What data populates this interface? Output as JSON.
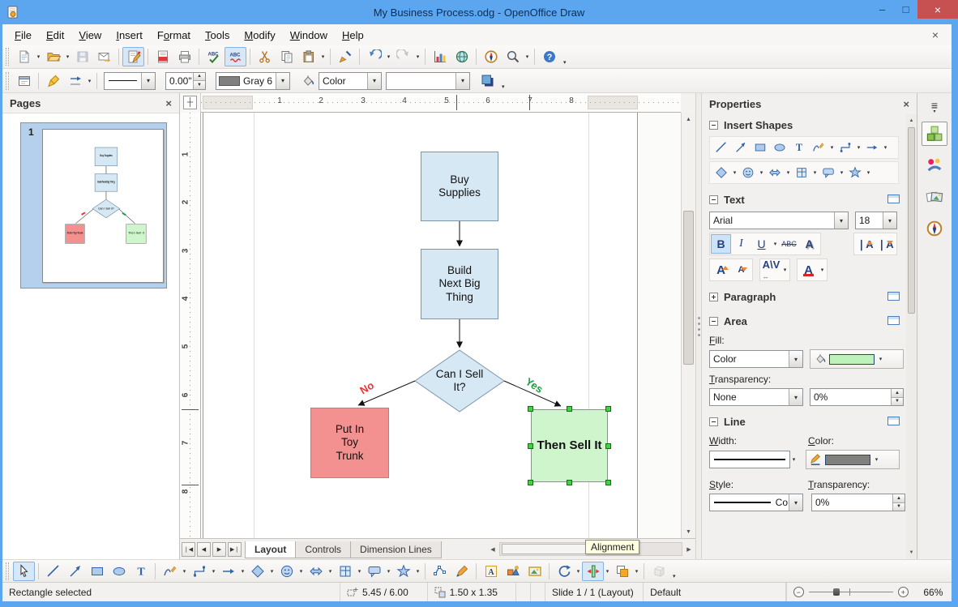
{
  "window": {
    "title": "My Business Process.odg - OpenOffice Draw",
    "minimize": "–",
    "maximize": "□",
    "close": "×"
  },
  "menu": {
    "close": "×",
    "items": [
      {
        "pre": "",
        "accel": "F",
        "post": "ile"
      },
      {
        "pre": "",
        "accel": "E",
        "post": "dit"
      },
      {
        "pre": "",
        "accel": "V",
        "post": "iew"
      },
      {
        "pre": "",
        "accel": "I",
        "post": "nsert"
      },
      {
        "pre": "F",
        "accel": "o",
        "post": "rmat"
      },
      {
        "pre": "",
        "accel": "T",
        "post": "ools"
      },
      {
        "pre": "",
        "accel": "M",
        "post": "odify"
      },
      {
        "pre": "",
        "accel": "W",
        "post": "indow"
      },
      {
        "pre": "",
        "accel": "H",
        "post": "elp"
      }
    ]
  },
  "toolbar_standard": {
    "icons": [
      "new-document",
      "open",
      "save",
      "email-document",
      "edit-mode",
      "export-pdf",
      "print",
      "spellcheck",
      "auto-spellcheck",
      "cut",
      "copy",
      "paste",
      "format-paintbrush",
      "undo",
      "redo",
      "insert-chart",
      "hyperlink",
      "navigator",
      "zoom",
      "help"
    ]
  },
  "toolbar_line_fill": {
    "icons": [
      "styles",
      "editpoints-pen",
      "arrow-style",
      "fill-bucket",
      "shadow"
    ],
    "line_width_value": "0.00\"",
    "line_color_value": "Gray 6",
    "fill_type_value": "Color",
    "fill_color_value": "",
    "line_color_hex": "#808080",
    "fill_color_hex": "#ffffff"
  },
  "pages_panel": {
    "title": "Pages",
    "close": "×",
    "page_number": "1"
  },
  "rulers": {
    "h": [
      "1",
      "2",
      "3",
      "4",
      "5",
      "6",
      "7",
      "8"
    ],
    "v": [
      "1",
      "2",
      "3",
      "4",
      "5",
      "6",
      "7",
      "8"
    ]
  },
  "canvas": {
    "nodes": [
      {
        "label": "Buy Supplies",
        "fill": "#d5e8f4"
      },
      {
        "label": "Build Next Big Thing",
        "fill": "#d5e8f4"
      },
      {
        "label": "Can I Sell It?",
        "fill": "#d5e8f4"
      },
      {
        "label": "Put In Toy Trunk",
        "fill": "#f2918f"
      },
      {
        "label": "Then Sell It",
        "fill": "#cff5cd",
        "selected": true
      }
    ],
    "edge_labels": {
      "no": "No",
      "yes": "Yes"
    },
    "edge_label_colors": {
      "no": "#E33",
      "yes": "#1E9E3E"
    },
    "handle_color": "#43D243"
  },
  "sheet_tabs": {
    "items": [
      {
        "label": "Layout",
        "active": true
      },
      {
        "label": "Controls",
        "active": false
      },
      {
        "label": "Dimension Lines",
        "active": false
      }
    ]
  },
  "tooltip": {
    "text": "Alignment"
  },
  "properties": {
    "title": "Properties",
    "close": "×",
    "insert_shapes": {
      "header": "Insert Shapes",
      "row1": [
        "line",
        "arrow",
        "rectangle",
        "ellipse",
        "text",
        "curve",
        "connector",
        "lines-arrows"
      ],
      "row2": [
        "basic-shapes",
        "symbol-shapes",
        "block-arrows",
        "flowcharts",
        "callouts",
        "stars"
      ]
    },
    "text": {
      "header": "Text",
      "font_name": "Arial",
      "font_size": "18",
      "bold": "B",
      "italic": "I",
      "underline": "U",
      "strike": "ABC",
      "shadow_btn": "A",
      "grow": "A",
      "shrink": "A",
      "spacing": "AV",
      "font_color": "A"
    },
    "paragraph": {
      "header": "Paragraph"
    },
    "area": {
      "header": "Area",
      "fill_label": "Fill:",
      "fill_type": "Color",
      "fill_color_hex": "#BDF2BB",
      "transparency_label": "Transparency:",
      "transparency_type": "None",
      "transparency_value": "0%"
    },
    "line": {
      "header": "Line",
      "width_label": "Width:",
      "color_label": "Color:",
      "color_hex": "#808080",
      "style_label": "Style:",
      "style_value": "Co",
      "transparency_label": "Transparency:",
      "transparency_value": "0%"
    }
  },
  "sidebar_tabs": {
    "icons": [
      "sidebar-menu",
      "properties-tab",
      "gallery-tab",
      "images-tab",
      "navigator-tab"
    ]
  },
  "drawing_toolbar": {
    "icons": [
      "select",
      "line",
      "arrow",
      "rectangle",
      "ellipse",
      "text",
      "curve",
      "connector",
      "lines-arrows",
      "basic-shapes",
      "symbol-shapes",
      "block-arrows",
      "flowcharts",
      "callouts",
      "stars",
      "edit-points",
      "glue-points",
      "fontwork",
      "from-file",
      "gallery",
      "rotate",
      "alignment",
      "arrange",
      "extrusion"
    ]
  },
  "status_bar": {
    "selection": "Rectangle selected",
    "position": "5.45 / 6.00",
    "size": "1.50 x 1.35",
    "slide": "Slide 1 / 1 (Layout)",
    "style": "Default",
    "zoom_level": "66%"
  }
}
